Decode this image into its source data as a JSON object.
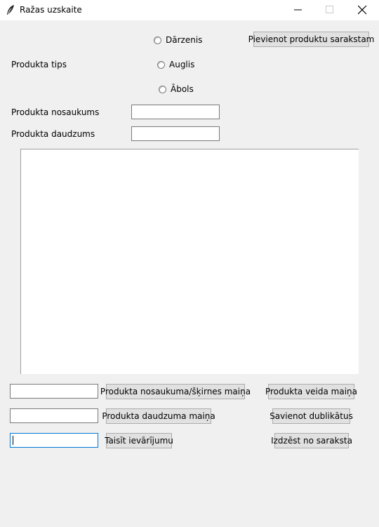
{
  "window": {
    "title": "Ražas uzskaite",
    "icon": "feather-icon",
    "controls": [
      "minimize-icon",
      "maximize-icon",
      "close-icon"
    ]
  },
  "form": {
    "type_label": "Produkta tips",
    "type_options": [
      "Dārzenis",
      "Auglis",
      "Ābols"
    ],
    "name_label": "Produkta nosaukums",
    "name_value": "",
    "quantity_label": "Produkta daudzums",
    "quantity_value": "",
    "add_button": "Pievienot produktu sarakstam"
  },
  "product_list": {
    "items": []
  },
  "edit": {
    "rename_input_value": "",
    "rename_button": "Produkta nosaukuma/šķirnes maiņa",
    "change_type_button": "Produkta veida maiņa",
    "quantity_input_value": "",
    "change_quantity_button": "Produkta daudzuma maiņa",
    "merge_duplicates_button": "Savienot dublikātus",
    "note_input_value": "",
    "make_note_button": "Taisīt ievārījumu",
    "delete_button": "Izdzēst no saraksta"
  },
  "colors": {
    "window_bg": "#f0f0f0",
    "button_bg": "#e1e1e1",
    "focus": "#0078d7"
  }
}
